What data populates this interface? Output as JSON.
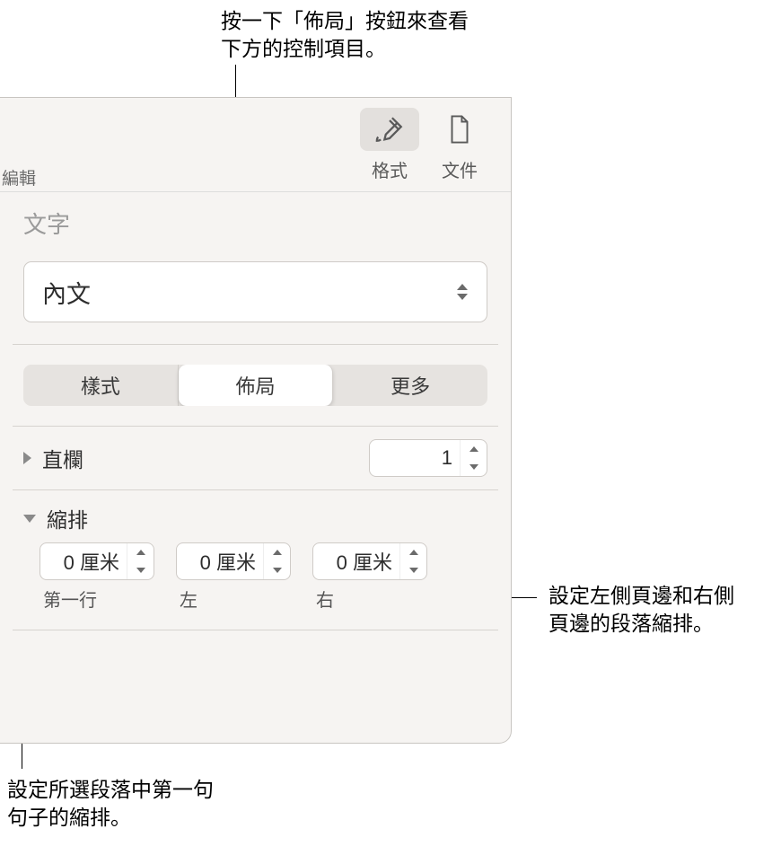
{
  "annotations": {
    "layout_hint_l1": "按一下「佈局」按鈕來查看",
    "layout_hint_l2": "下方的控制項目。",
    "margin_indent_l1": "設定左側頁邊和右側",
    "margin_indent_l2": "頁邊的段落縮排。",
    "firstline_l1": "設定所選段落中第一句",
    "firstline_l2": "句子的縮排。"
  },
  "toolbar": {
    "edit_label": "編輯",
    "format_label": "格式",
    "document_label": "文件"
  },
  "section_title": "文字",
  "style_dropdown": {
    "value": "內文"
  },
  "tabs": {
    "style": "樣式",
    "layout": "佈局",
    "more": "更多"
  },
  "columns": {
    "label": "直欄",
    "value": "1"
  },
  "indent": {
    "label": "縮排",
    "first": {
      "value": "0 厘米",
      "label": "第一行"
    },
    "left": {
      "value": "0 厘米",
      "label": "左"
    },
    "right": {
      "value": "0 厘米",
      "label": "右"
    }
  }
}
